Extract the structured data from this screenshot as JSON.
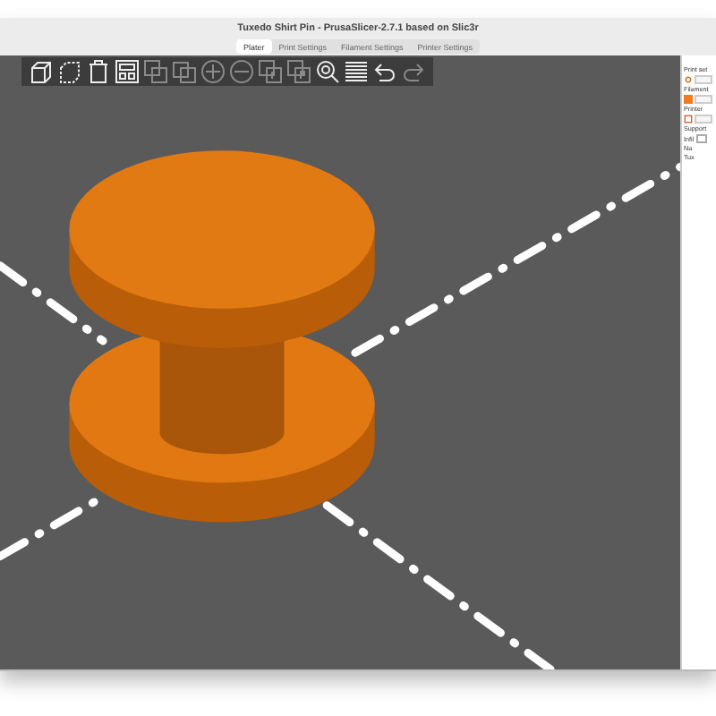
{
  "window": {
    "title": "Tuxedo Shirt Pin - PrusaSlicer-2.7.1 based on Slic3r"
  },
  "tabs": [
    {
      "label": "Plater",
      "selected": true
    },
    {
      "label": "Print Settings",
      "selected": false
    },
    {
      "label": "Filament Settings",
      "selected": false
    },
    {
      "label": "Printer Settings",
      "selected": false
    }
  ],
  "sidebar": {
    "items": [
      {
        "kind": "label",
        "text": "Print set"
      },
      {
        "kind": "print-combo"
      },
      {
        "kind": "label",
        "text": "Filament"
      },
      {
        "kind": "filament-combo",
        "color": "#f07c1c"
      },
      {
        "kind": "label",
        "text": "Printer"
      },
      {
        "kind": "printer-combo"
      },
      {
        "kind": "label",
        "text": "Support"
      },
      {
        "kind": "field",
        "text": "Infil"
      },
      {
        "kind": "label",
        "text": "Na"
      },
      {
        "kind": "label",
        "text": "Tux"
      }
    ]
  }
}
